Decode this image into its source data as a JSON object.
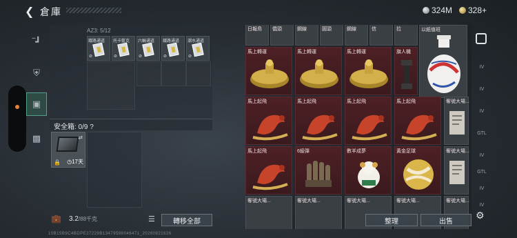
{
  "header": {
    "back_icon": "chevron-left-icon",
    "title": "倉庫"
  },
  "currency": [
    {
      "icon": "silver-coin-icon",
      "value": "324M"
    },
    {
      "icon": "gold-coin-icon",
      "value": "328+"
    }
  ],
  "left_nav": [
    {
      "icon": "gun-icon",
      "active": false
    },
    {
      "icon": "helmet-icon",
      "active": false
    },
    {
      "icon": "backpack-icon",
      "active": true
    },
    {
      "icon": "briefcase-icon",
      "active": false
    }
  ],
  "container": {
    "label": "AZ3: 5/12",
    "items": [
      {
        "name": "鐵路通道",
        "icon": "ticket-card-icon"
      },
      {
        "name": "托卡藍克",
        "icon": "ticket-card-icon"
      },
      {
        "name": "六輪通道",
        "icon": "ticket-card-icon"
      },
      {
        "name": "鐵路通道",
        "icon": "ticket-card-icon"
      },
      {
        "name": "潮水通道",
        "icon": "ticket-card-icon"
      }
    ]
  },
  "safe": {
    "label": "安全箱: 0/9 ?",
    "timer": "17天",
    "swap_icon": "swap-icon",
    "lock_icon": "lock-icon"
  },
  "bottom": {
    "weight": "3.2",
    "weight_unit": "/88千克",
    "transfer_all": "轉移全部",
    "organize": "整理",
    "sell": "出售"
  },
  "inventory": {
    "top_row_labels": [
      "日報鳥",
      "僑頭",
      "鋼線",
      "圓頭",
      "鋼線",
      "信",
      "拉",
      "以紙值班"
    ],
    "rows": [
      [
        {
          "label": "馬上轉運",
          "icon": "gold-compass-icon"
        },
        {
          "label": "馬上轉運",
          "icon": "gold-compass-icon"
        },
        {
          "label": "馬上轉運",
          "icon": "gold-compass-icon"
        },
        {
          "label": "旗人機",
          "icon": "dumbbell-icon"
        }
      ],
      [
        {
          "label": "馬上起飛",
          "icon": "red-horse-icon"
        },
        {
          "label": "馬上起飛",
          "icon": "red-horse-icon"
        },
        {
          "label": "馬上起飛",
          "icon": "red-horse-icon"
        },
        {
          "label": "馬上起飛",
          "icon": "red-horse-icon"
        },
        {
          "label": "奪號大場...",
          "icon": "document-icon"
        }
      ],
      [
        {
          "label": "馬上起飛",
          "icon": "red-horse-icon"
        },
        {
          "label": "6級彈",
          "icon": "bullets-icon"
        },
        {
          "label": "數羊成夢",
          "icon": "sheep-icon"
        },
        {
          "label": "黃金足球",
          "icon": "gold-ball-icon"
        },
        {
          "label": "奪號大場...",
          "icon": "document-icon"
        }
      ],
      [
        {
          "label": "奪號大場...",
          "icon": "document-icon"
        },
        {
          "label": "奪號大場...",
          "icon": "document-icon"
        },
        {
          "label": "奪號大場...",
          "icon": "document-icon"
        },
        {
          "label": "奪號大場...",
          "icon": "document-icon"
        },
        {
          "label": "奪號大場...",
          "icon": "document-icon"
        }
      ]
    ],
    "big_item": {
      "label": "以紙值班",
      "icon": "porcelain-vase-icon"
    }
  },
  "right_tabs": [
    "IV",
    "IV",
    "IV",
    "GTL",
    "IV",
    "GTL",
    "IV",
    "IV"
  ],
  "footer": "10B15B9C4BDPE27229B13479598046471_20260821626",
  "colors": {
    "accent": "#58a08e",
    "slot_red": "#4e2025",
    "gold": "#d4a84a"
  }
}
